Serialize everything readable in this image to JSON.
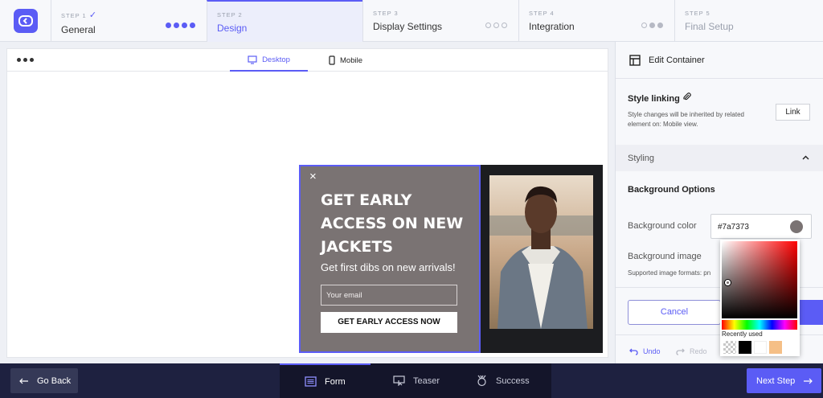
{
  "steps": [
    {
      "label": "STEP 1",
      "name": "General",
      "done": "✓"
    },
    {
      "label": "STEP 2",
      "name": "Design"
    },
    {
      "label": "STEP 3",
      "name": "Display Settings"
    },
    {
      "label": "STEP 4",
      "name": "Integration"
    },
    {
      "label": "STEP 5",
      "name": "Final Setup"
    }
  ],
  "canvas": {
    "tab_desktop": "Desktop",
    "tab_mobile": "Mobile"
  },
  "popup": {
    "close": "×",
    "headline": "GET EARLY ACCESS ON NEW JACKETS",
    "subheadline": "Get first dibs on new arrivals!",
    "email_placeholder": "Your email",
    "cta_label": "GET EARLY ACCESS NOW"
  },
  "panel": {
    "title": "Edit Container",
    "style_linking": "Style linking",
    "style_linking_desc": "Style changes will be inherited by related element on: Mobile view.",
    "link_label": "Link",
    "styling": "Styling",
    "background_options": "Background Options",
    "background_color_label": "Background color",
    "background_color_value": "#7a7373",
    "background_image_label": "Background image",
    "supported_formats": "Supported image formats: pn",
    "cancel_label": "Cancel",
    "undo_label": "Undo",
    "redo_label": "Redo"
  },
  "color_picker": {
    "recently_used_label": "Recently used",
    "recent_colors": [
      "transparent",
      "#000000",
      "#ffffff",
      "#f5bf86"
    ]
  },
  "bottom": {
    "back_label": "Go Back",
    "tab_form": "Form",
    "tab_teaser": "Teaser",
    "tab_success": "Success",
    "next_label": "Next Step"
  },
  "colors": {
    "accent": "#5b5cf5",
    "popup_bg": "#7a7373"
  }
}
